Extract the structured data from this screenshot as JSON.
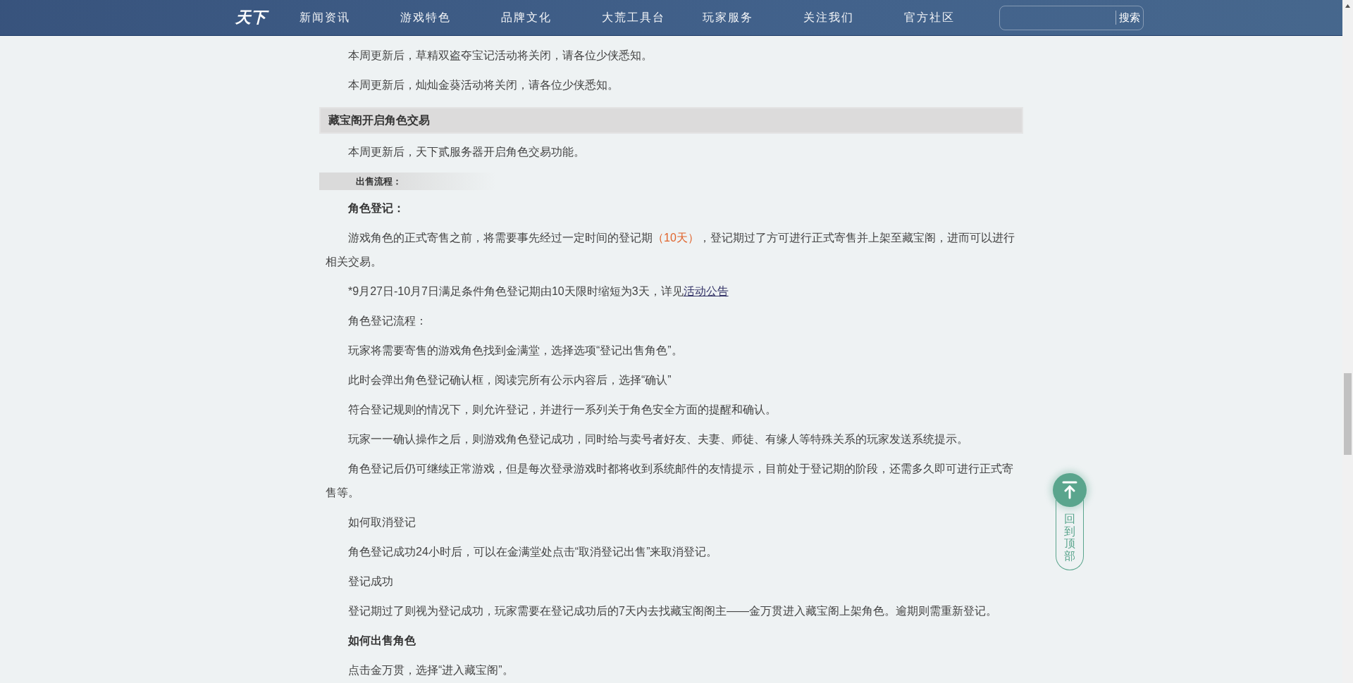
{
  "header": {
    "logo": "天下",
    "nav": [
      "新闻资讯",
      "游戏特色",
      "品牌文化",
      "大荒工具台",
      "玩家服务",
      "关注我们",
      "官方社区"
    ],
    "search": {
      "button": "搜索"
    }
  },
  "article": [
    {
      "kind": "para",
      "parts": [
        {
          "kind": "plain",
          "text": "本周更新后，草精双盗夺宝记活动将关闭，请各位少侠悉知。"
        }
      ]
    },
    {
      "kind": "para",
      "parts": [
        {
          "kind": "plain",
          "text": "本周更新后，灿灿金葵活动将关闭，请各位少侠悉知。"
        }
      ]
    },
    {
      "kind": "section",
      "text": "藏宝阁开启角色交易"
    },
    {
      "kind": "para",
      "parts": [
        {
          "kind": "plain",
          "text": "本周更新后，天下贰服务器开启角色交易功能。"
        }
      ]
    },
    {
      "kind": "subsection",
      "text": "出售流程："
    },
    {
      "kind": "bold",
      "text": "角色登记："
    },
    {
      "kind": "para",
      "parts": [
        {
          "kind": "plain",
          "text": "游戏角色的正式寄售之前，将需要事先经过一定时间的登记期"
        },
        {
          "kind": "highlight",
          "text": "（10天）"
        },
        {
          "kind": "plain",
          "text": "，登记期过了方可进行正式寄售并上架至藏宝阁，进而可以进行相关交易。"
        }
      ]
    },
    {
      "kind": "para",
      "parts": [
        {
          "kind": "plain",
          "text": "*9月27日-10月7日满足条件角色登记期由10天限时缩短为3天，详见"
        },
        {
          "kind": "link",
          "text": "活动公告"
        }
      ]
    },
    {
      "kind": "para",
      "parts": [
        {
          "kind": "plain",
          "text": "角色登记流程："
        }
      ]
    },
    {
      "kind": "para",
      "parts": [
        {
          "kind": "plain",
          "text": "玩家将需要寄售的游戏角色找到金满堂，选择选项“登记出售角色”。"
        }
      ]
    },
    {
      "kind": "para",
      "parts": [
        {
          "kind": "plain",
          "text": "此时会弹出角色登记确认框，阅读完所有公示内容后，选择“确认”"
        }
      ]
    },
    {
      "kind": "para",
      "parts": [
        {
          "kind": "plain",
          "text": "符合登记规则的情况下，则允许登记，并进行一系列关于角色安全方面的提醒和确认。"
        }
      ]
    },
    {
      "kind": "para",
      "parts": [
        {
          "kind": "plain",
          "text": "玩家一一确认操作之后，则游戏角色登记成功，同时给与卖号者好友、夫妻、师徒、有缘人等特殊关系的玩家发送系统提示。"
        }
      ]
    },
    {
      "kind": "para",
      "parts": [
        {
          "kind": "plain",
          "text": "角色登记后仍可继续正常游戏，但是每次登录游戏时都将收到系统邮件的友情提示，目前处于登记期的阶段，还需多久即可进行正式寄售等。"
        }
      ]
    },
    {
      "kind": "para",
      "parts": [
        {
          "kind": "plain",
          "text": "如何取消登记"
        }
      ]
    },
    {
      "kind": "para",
      "parts": [
        {
          "kind": "plain",
          "text": "角色登记成功24小时后，可以在金满堂处点击“取消登记出售”来取消登记。"
        }
      ]
    },
    {
      "kind": "para",
      "parts": [
        {
          "kind": "plain",
          "text": "登记成功"
        }
      ]
    },
    {
      "kind": "para",
      "parts": [
        {
          "kind": "plain",
          "text": "登记期过了则视为登记成功，玩家需要在登记成功后的7天内去找藏宝阁阁主——金万贯进入藏宝阁上架角色。逾期则需重新登记。"
        }
      ]
    },
    {
      "kind": "bold",
      "text": "如何出售角色"
    },
    {
      "kind": "para",
      "parts": [
        {
          "kind": "plain",
          "text": "点击金万贯，选择“进入藏宝阁”。"
        }
      ]
    }
  ],
  "back_to_top": {
    "label": "回到顶部"
  }
}
